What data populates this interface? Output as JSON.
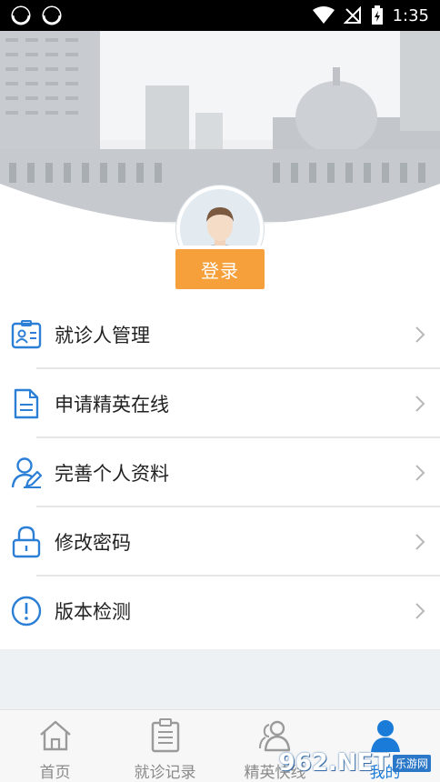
{
  "status_bar": {
    "time": "1:35"
  },
  "login_button": "登录",
  "menu": [
    {
      "label": "就诊人管理",
      "icon": "patient-card-icon"
    },
    {
      "label": "申请精英在线",
      "icon": "document-icon"
    },
    {
      "label": "完善个人资料",
      "icon": "user-edit-icon"
    },
    {
      "label": "修改密码",
      "icon": "lock-icon"
    },
    {
      "label": "版本检测",
      "icon": "info-icon"
    }
  ],
  "tabs": [
    {
      "label": "首页",
      "icon": "home-icon"
    },
    {
      "label": "就诊记录",
      "icon": "clipboard-icon"
    },
    {
      "label": "精英快线",
      "icon": "people-icon"
    },
    {
      "label": "我的",
      "icon": "profile-icon",
      "active": true
    }
  ],
  "watermark": {
    "logo": "962.NET",
    "sub": "乐游网"
  },
  "colors": {
    "accent": "#1b7bd8",
    "login": "#f5a03a",
    "icon_blue": "#2b7fd6"
  }
}
